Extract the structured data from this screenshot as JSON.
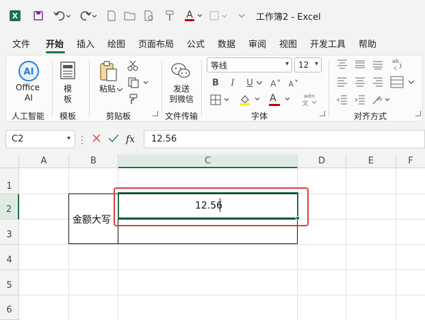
{
  "titlebar": {
    "title": "工作簿2 - Excel",
    "icons": [
      "excel-logo-icon",
      "save-icon",
      "undo-icon",
      "redo-icon",
      "new-file-icon",
      "open-folder-icon",
      "print-preview-icon",
      "format-painter-icon",
      "font-color-icon",
      "borders-icon",
      "customize-dropdown-icon"
    ]
  },
  "menu": {
    "tabs": [
      "文件",
      "开始",
      "插入",
      "绘图",
      "页面布局",
      "公式",
      "数据",
      "审阅",
      "视图",
      "开发工具",
      "帮助"
    ],
    "active": "开始"
  },
  "ribbon": {
    "ai": {
      "label_line1": "Office",
      "label_line2": "AI",
      "group": "人工智能"
    },
    "template": {
      "label_line1": "模",
      "label_line2": "板",
      "group": "模板"
    },
    "clipboard": {
      "paste": "粘贴",
      "group": "剪贴板"
    },
    "file_transfer": {
      "label_line1": "发送",
      "label_line2": "到微信",
      "group": "文件传输"
    },
    "font": {
      "name": "等线",
      "size": "12",
      "bold": "B",
      "italic": "I",
      "underline": "U",
      "font_color_glyph": "A",
      "phonetic": "wén",
      "group": "字体",
      "font_color": "#c00000"
    },
    "alignment": {
      "group": "对齐方式"
    }
  },
  "formula_bar": {
    "name_box": "C2",
    "fx": "fx",
    "value": "12.56"
  },
  "grid": {
    "columns": [
      "A",
      "B",
      "C",
      "D",
      "E",
      "F"
    ],
    "rows": [
      "1",
      "2",
      "3",
      "4",
      "5",
      "6"
    ],
    "selected_cell": "C2",
    "cells": {
      "B2": "金额大写",
      "C2": "12.56"
    },
    "highlight_color": "#e03c3c",
    "selection_color": "#1e7145"
  }
}
